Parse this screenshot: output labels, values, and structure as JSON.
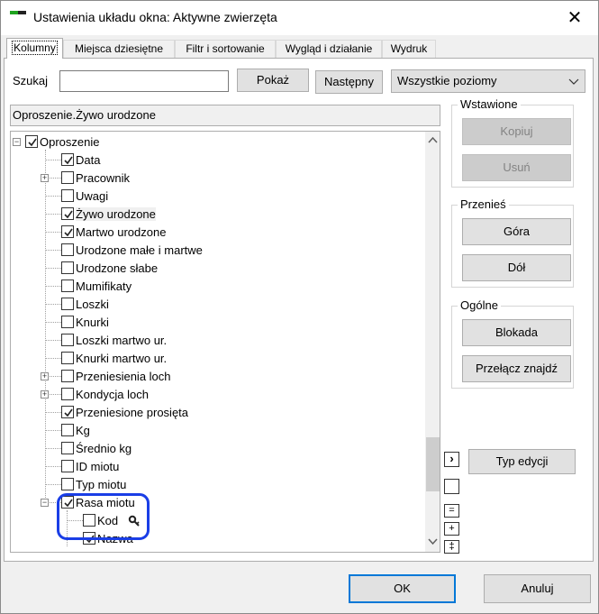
{
  "window": {
    "title": "Ustawienia układu okna: Aktywne zwierzęta",
    "close_glyph": "✕"
  },
  "tabs": [
    {
      "label": "Kolumny",
      "active": true
    },
    {
      "label": "Miejsca dziesiętne",
      "active": false
    },
    {
      "label": "Filtr i sortowanie",
      "active": false
    },
    {
      "label": "Wygląd i działanie",
      "active": false
    },
    {
      "label": "Wydruk",
      "active": false
    }
  ],
  "search": {
    "label": "Szukaj",
    "value": "",
    "show_button": "Pokaż",
    "next_button": "Następny",
    "level_select": "Wszystkie poziomy",
    "chevron": "⌄"
  },
  "path": "Oproszenie.Żywo urodzone",
  "tree": {
    "nodes": [
      {
        "label": "Oproszenie",
        "checked": true,
        "expander": "−"
      },
      {
        "label": "Data",
        "checked": true,
        "expander": ""
      },
      {
        "label": "Pracownik",
        "checked": false,
        "expander": "+"
      },
      {
        "label": "Uwagi",
        "checked": false,
        "expander": ""
      },
      {
        "label": "Żywo urodzone",
        "checked": true,
        "expander": "",
        "selected": true
      },
      {
        "label": "Martwo urodzone",
        "checked": true,
        "expander": ""
      },
      {
        "label": "Urodzone małe i martwe",
        "checked": false,
        "expander": ""
      },
      {
        "label": "Urodzone słabe",
        "checked": false,
        "expander": ""
      },
      {
        "label": "Mumifikaty",
        "checked": false,
        "expander": ""
      },
      {
        "label": "Loszki",
        "checked": false,
        "expander": ""
      },
      {
        "label": "Knurki",
        "checked": false,
        "expander": ""
      },
      {
        "label": "Loszki martwo ur.",
        "checked": false,
        "expander": ""
      },
      {
        "label": "Knurki martwo ur.",
        "checked": false,
        "expander": ""
      },
      {
        "label": "Przeniesienia loch",
        "checked": false,
        "expander": "+"
      },
      {
        "label": "Kondycja loch",
        "checked": false,
        "expander": "+"
      },
      {
        "label": "Przeniesione prosięta",
        "checked": true,
        "expander": ""
      },
      {
        "label": "Kg",
        "checked": false,
        "expander": ""
      },
      {
        "label": "Średnio kg",
        "checked": false,
        "expander": ""
      },
      {
        "label": "ID miotu",
        "checked": false,
        "expander": ""
      },
      {
        "label": "Typ miotu",
        "checked": false,
        "expander": ""
      },
      {
        "label": "Rasa miotu",
        "checked": true,
        "expander": "−"
      },
      {
        "label": "Kod",
        "checked": false,
        "expander": "",
        "child": true,
        "has_key_icon": true
      },
      {
        "label": "Nazwa",
        "checked": true,
        "expander": "",
        "child": true
      }
    ]
  },
  "groups": {
    "inserted": {
      "title": "Wstawione",
      "copy": "Kopiuj",
      "delete": "Usuń"
    },
    "move": {
      "title": "Przenieś",
      "up": "Góra",
      "down": "Dół"
    },
    "general": {
      "title": "Ogólne",
      "lock": "Blokada",
      "toggle_found": "Przełącz znajdź"
    }
  },
  "side_buttons": {
    "arrow": "›",
    "collapse": "=",
    "expand": "+",
    "expand_all": "‡"
  },
  "edit_type_button": "Typ edycji",
  "footer": {
    "ok": "OK",
    "cancel": "Anuluj"
  },
  "scroll": {
    "up": "˄",
    "down": "˅"
  },
  "colors": {
    "accent": "#0078d7",
    "highlight_ring": "#1a3ee6",
    "app_icon_green": "#1fa31f"
  }
}
